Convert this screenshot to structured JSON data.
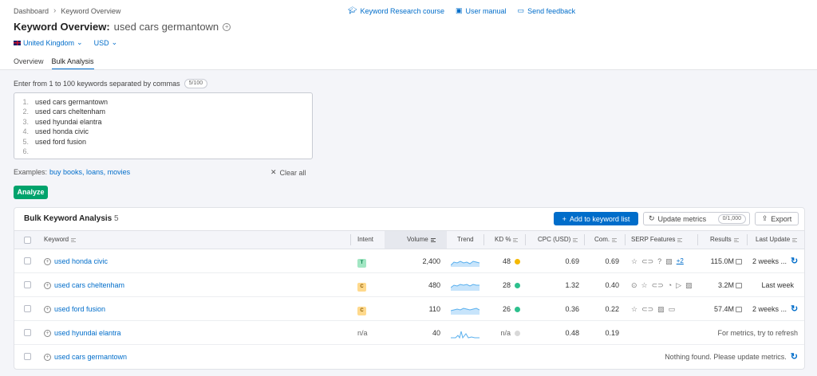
{
  "breadcrumb": {
    "root": "Dashboard",
    "current": "Keyword Overview"
  },
  "toplinks": {
    "course": "Keyword Research course",
    "manual": "User manual",
    "feedback": "Send feedback"
  },
  "header": {
    "title": "Keyword Overview:",
    "keyword": "used cars germantown"
  },
  "locale": {
    "country": "United Kingdom",
    "currency": "USD"
  },
  "tabs": [
    "Overview",
    "Bulk Analysis"
  ],
  "input": {
    "prompt": "Enter from 1 to 100 keywords separated by commas",
    "count": "5/100",
    "lines": [
      {
        "n": "1.",
        "text": "used cars germantown"
      },
      {
        "n": "2.",
        "text": "used cars cheltenham"
      },
      {
        "n": "3.",
        "text": "used hyundai elantra"
      },
      {
        "n": "4.",
        "text": "used honda civic"
      },
      {
        "n": "5.",
        "text": "used ford fusion"
      },
      {
        "n": "6.",
        "text": ""
      }
    ],
    "examples_label": "Examples:",
    "examples": "buy books, loans, movies",
    "clear": "Clear all",
    "analyze": "Analyze"
  },
  "panel": {
    "title": "Bulk Keyword Analysis",
    "count": "5",
    "add_button": "Add to keyword list",
    "update_button": "Update metrics",
    "update_count": "0/1,000",
    "export_button": "Export"
  },
  "columns": {
    "keyword": "Keyword",
    "intent": "Intent",
    "volume": "Volume",
    "trend": "Trend",
    "kd": "KD %",
    "cpc": "CPC (USD)",
    "com": "Com.",
    "serp": "SERP Features",
    "results": "Results",
    "updated": "Last Update"
  },
  "rows": [
    {
      "keyword": "used honda civic",
      "intent": "T",
      "volume": "2,400",
      "kd": "48",
      "cpc": "0.69",
      "com": "0.69",
      "serp_more": "+2",
      "results": "115.0M",
      "updated": "2 weeks ...",
      "msg": ""
    },
    {
      "keyword": "used cars cheltenham",
      "intent": "C",
      "volume": "480",
      "kd": "28",
      "cpc": "1.32",
      "com": "0.40",
      "serp_more": "",
      "results": "3.2M",
      "updated": "Last week",
      "msg": ""
    },
    {
      "keyword": "used ford fusion",
      "intent": "C",
      "volume": "110",
      "kd": "26",
      "cpc": "0.36",
      "com": "0.22",
      "serp_more": "",
      "results": "57.4M",
      "updated": "2 weeks ...",
      "msg": ""
    },
    {
      "keyword": "used hyundai elantra",
      "intent": "n/a",
      "volume": "40",
      "kd": "n/a",
      "cpc": "0.48",
      "com": "0.19",
      "serp_more": "",
      "results": "",
      "updated": "",
      "msg": "For metrics, try to refresh"
    },
    {
      "keyword": "used cars germantown",
      "intent": "",
      "volume": "",
      "kd": "",
      "cpc": "",
      "com": "",
      "serp_more": "",
      "results": "",
      "updated": "",
      "msg": "Nothing found. Please update metrics."
    }
  ],
  "colors": {
    "accent": "#006dca",
    "analyze": "#00a36c",
    "kd_medium": "#f5b800",
    "kd_easy": "#2dc08d",
    "kd_none": "#d8d8d8",
    "intent_t_bg": "#a2e6c3",
    "intent_t_fg": "#00804a",
    "intent_c_bg": "#ffd98c",
    "intent_c_fg": "#8a5a00"
  }
}
